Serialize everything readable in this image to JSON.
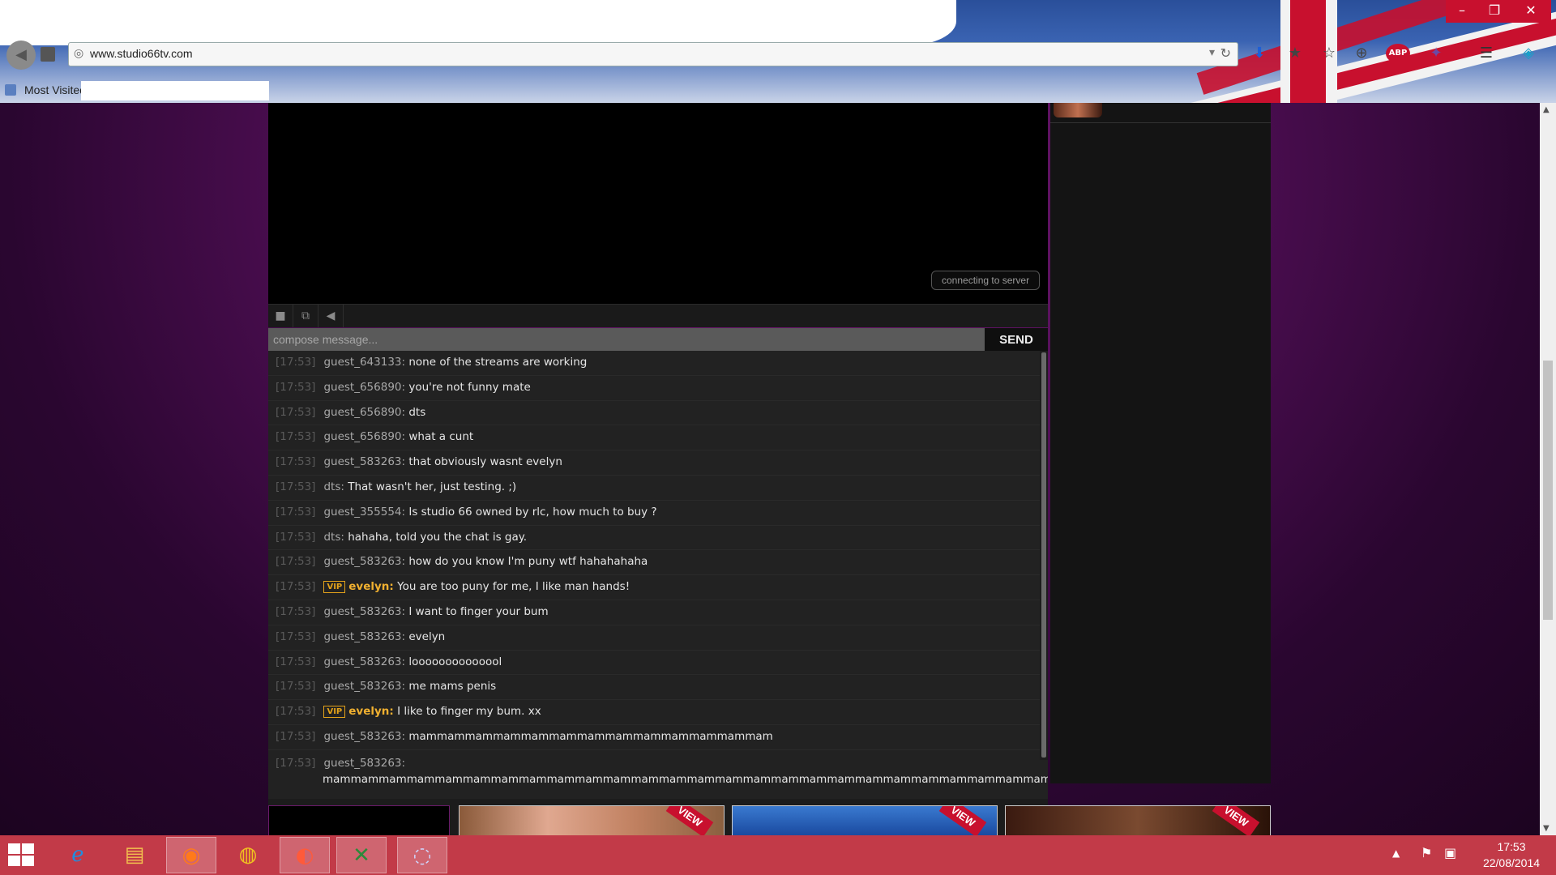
{
  "browser": {
    "url": "www.studio66tv.com",
    "bookmarks_label": "Most Visited",
    "window_buttons": {
      "minimize": "–",
      "maximize": "❐",
      "close": "✕"
    },
    "toolbar_icons": [
      "download-icon",
      "bookmark-star-icon",
      "bookmarks-icon",
      "globe-icon",
      "adblock-icon",
      "extension-icon",
      "menu-icon",
      "extension-icon"
    ],
    "abp_label": "ABP"
  },
  "player": {
    "status": "connecting to server",
    "controls": {
      "stop": "■",
      "popout": "⧉",
      "volume": "◀"
    }
  },
  "composer": {
    "placeholder": "compose message...",
    "send_label": "SEND"
  },
  "chat": {
    "vip_badge": "VIP",
    "messages": [
      {
        "time": "[17:53]",
        "user": "guest_643133:",
        "text": "none of the streams are working"
      },
      {
        "time": "[17:53]",
        "user": "guest_656890:",
        "text": "you're not funny mate"
      },
      {
        "time": "[17:53]",
        "user": "guest_656890:",
        "text": "dts"
      },
      {
        "time": "[17:53]",
        "user": "guest_656890:",
        "text": "what a cunt"
      },
      {
        "time": "[17:53]",
        "user": "guest_583263:",
        "text": "that obviously wasnt evelyn"
      },
      {
        "time": "[17:53]",
        "user": "dts:",
        "text": "That wasn't her, just testing. ;)"
      },
      {
        "time": "[17:53]",
        "user": "guest_355554:",
        "text": "Is studio 66 owned by rlc, how much to buy ?"
      },
      {
        "time": "[17:53]",
        "user": "dts:",
        "text": "hahaha, told you the chat is gay."
      },
      {
        "time": "[17:53]",
        "user": "guest_583263:",
        "text": "how do you know I'm puny wtf hahahahaha"
      },
      {
        "time": "[17:53]",
        "user": "evelyn:",
        "text": "You are too puny for me, I like man hands!",
        "vip": true
      },
      {
        "time": "[17:53]",
        "user": "guest_583263:",
        "text": "I want to finger your bum"
      },
      {
        "time": "[17:53]",
        "user": "guest_583263:",
        "text": "evelyn"
      },
      {
        "time": "[17:53]",
        "user": "guest_583263:",
        "text": "loooooooooooool"
      },
      {
        "time": "[17:53]",
        "user": "guest_583263:",
        "text": "me mams penis"
      },
      {
        "time": "[17:53]",
        "user": "evelyn:",
        "text": "I like to finger my bum. xx",
        "vip": true
      },
      {
        "time": "[17:53]",
        "user": "guest_583263:",
        "text": "mammammammammammammammammammammammammam"
      },
      {
        "time": "[17:53]",
        "user": "guest_583263:",
        "text": "mammammammammammammammammammammammammammammammammammammammammammammammammammammammammammammammammammammamma"
      }
    ]
  },
  "thumbnails": {
    "view_label": "VIEW"
  },
  "taskbar": {
    "time": "17:53",
    "date": "22/08/2014"
  }
}
